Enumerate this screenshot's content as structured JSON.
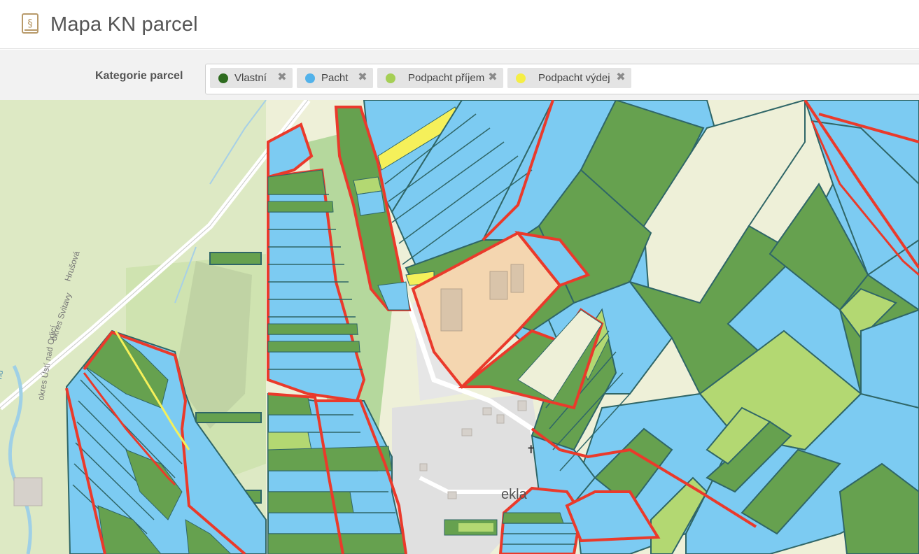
{
  "header": {
    "title": "Mapa KN parcel",
    "icon": "section-book-icon"
  },
  "filter": {
    "label": "Kategorie parcel",
    "chips": [
      {
        "label": "Vlastní",
        "color": "#2e6b1f"
      },
      {
        "label": "Pacht",
        "color": "#52b2ea"
      },
      {
        "label": "Podpacht příjem",
        "color": "#a5cf55"
      },
      {
        "label": "Podpacht výdej",
        "color": "#f5ee45"
      }
    ]
  },
  "map": {
    "labels": {
      "road": "Hrušová",
      "district": "okres Svitavy",
      "district2": "okres Ústí nad Orlicí",
      "village": "ekla",
      "edge": "nd"
    },
    "colors": {
      "vlastni": "#66a14f",
      "pacht": "#7ccbf2",
      "podpacht_prijem": "#b3d872",
      "podpacht_vydej": "#f5f05a",
      "highlight": "#ea3a2b",
      "border": "#2f6667"
    }
  }
}
